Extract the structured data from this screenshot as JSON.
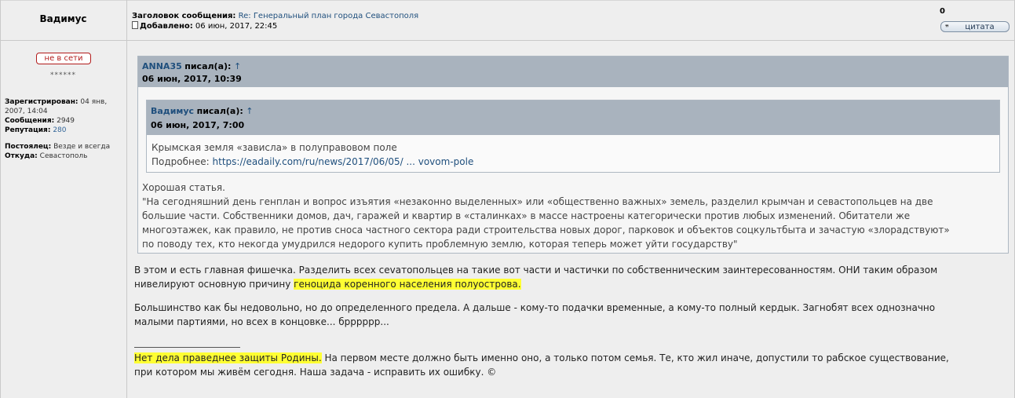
{
  "author": {
    "name": "Вадимус",
    "status": "не в сети",
    "rank_stars": "******",
    "registered_label": "Зарегистрирован:",
    "registered_value": "04 янв, 2007, 14:04",
    "posts_label": "Сообщения:",
    "posts_value": "2949",
    "reputation_label": "Репутация:",
    "reputation_value": "280",
    "member_label": "Постоялец:",
    "member_value": "Везде и всегда",
    "from_label": "Откуда:",
    "from_value": "Севастополь"
  },
  "header": {
    "subject_label": "Заголовок сообщения:",
    "subject_value": "Re: Генеральный план города Севастополя",
    "added_label": "Добавлено:",
    "added_value": "06 июн, 2017, 22:45",
    "count": "0",
    "quote_button": "цитата"
  },
  "quote_outer": {
    "author": "ANNA35",
    "wrote": "писал(а):",
    "arrow": "↑",
    "date": "06 июн, 2017, 10:39",
    "text_1": "Хорошая статья.",
    "text_2": "\"На сегодняшний день генплан и вопрос изъятия «незаконно выделенных» или «общественно важных» земель, разделил крымчан и севастопольцев на две",
    "text_3": "большие части. Собственники домов, дач, гаражей и квартир в «сталинках» в массе настроены категорически против любых изменений. Обитатели же",
    "text_4": "многоэтажек, как правило, не против сноса частного сектора ради строительства новых дорог, парковок и объектов соцкультбыта и зачастую «злорадствуют»",
    "text_5": "по поводу тех, кто некогда умудрился недорого купить проблемную землю, которая теперь может уйти государству\""
  },
  "quote_inner": {
    "author": "Вадимус",
    "wrote": "писал(а):",
    "arrow": "↑",
    "date": "06 июн, 2017, 7:00",
    "text_1": "Крымская земля «зависла» в полуправовом поле",
    "more_label": "Подробнее:",
    "link": "https://eadaily.com/ru/news/2017/06/05/ ... vovom-pole"
  },
  "body": {
    "p1_line1": "В этом и есть главная фишечка. Разделить всех сevатопольцев на такие вот части и частички по собственническим заинтересованностям. ОНИ таким образом",
    "p1_line2_a": "нивелируют основную причину ",
    "p1_line2_hl": "геноцида коренного населения полуострова.",
    "p2_line1": "Большинство как бы недовольно, но до определенного предела. А дальше - кому-то подачки временные, а кому-то полный кердык. Загнобят всех однозначно",
    "p2_line2": "малыми партиями, но всех в концовке... брррррр...",
    "sig_hl": "Нет дела праведнее защиты Родины.",
    "sig_line1_rest": " На первом месте должно быть именно оно, а только потом семья. Те, кто жил иначе, допустили то рабское существование,",
    "sig_line2": "при котором мы живём сегодня. Наша задача - исправить их ошибку. ©"
  },
  "colors": {
    "link": "#1f4f7d",
    "quote_header": "#a9b3be",
    "highlight": "#ffff33",
    "offline": "#b21b1b"
  }
}
